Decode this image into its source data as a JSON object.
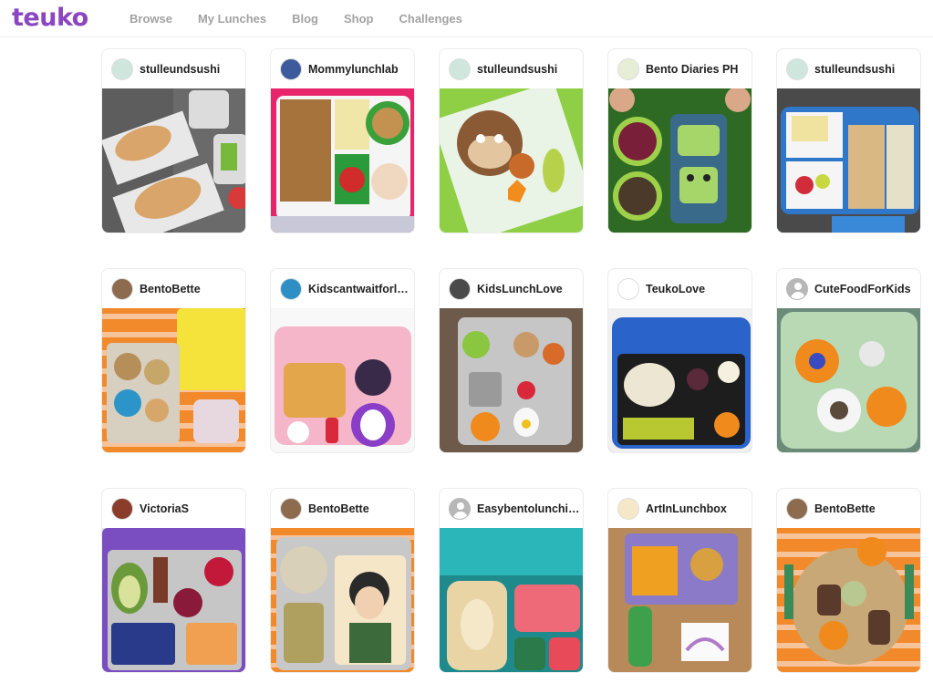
{
  "app": {
    "logo": "teuko"
  },
  "nav": [
    {
      "label": "Browse"
    },
    {
      "label": "My Lunches"
    },
    {
      "label": "Blog"
    },
    {
      "label": "Shop"
    },
    {
      "label": "Challenges"
    }
  ],
  "cards": [
    {
      "user": "stulleundsushi",
      "avatar": "#cfe6dd",
      "scene": "gingerbread",
      "colors": [
        "#5d5d5d",
        "#d9a56a",
        "#e8e8e8",
        "#78b83a"
      ]
    },
    {
      "user": "Mommylunchlab",
      "avatar": "#3d5a9c",
      "scene": "bento4",
      "colors": [
        "#e8246a",
        "#a7733c",
        "#f0e6a8",
        "#d12c2c"
      ]
    },
    {
      "user": "stulleundsushi",
      "avatar": "#cfe6dd",
      "scene": "monkey",
      "colors": [
        "#8fcf46",
        "#8a5a35",
        "#f28c1c",
        "#e8e8e8"
      ]
    },
    {
      "user": "Bento Diaries PH",
      "avatar": "#e6efd6",
      "scene": "frog",
      "colors": [
        "#3c7a2a",
        "#7a1f3a",
        "#a6d66a",
        "#4b3a2a"
      ]
    },
    {
      "user": "stulleundsushi",
      "avatar": "#cfe6dd",
      "scene": "sandwich",
      "colors": [
        "#2f77c9",
        "#d9b884",
        "#f08a1c",
        "#e7e0c9"
      ]
    },
    {
      "user": "BentoBette",
      "avatar": "#8d6b4e",
      "scene": "tray",
      "colors": [
        "#f28a2c",
        "#b58e5a",
        "#f5e23a",
        "#2b95c9"
      ]
    },
    {
      "user": "Kidscantwaitforlunch",
      "avatar": "#2e8fc4",
      "scene": "waffle",
      "colors": [
        "#f4b6c8",
        "#e3a64a",
        "#8a3ec7",
        "#ffffff"
      ]
    },
    {
      "user": "KidsLunchLove",
      "avatar": "#4a4a4a",
      "scene": "metal",
      "colors": [
        "#6d5a4a",
        "#c6c6c6",
        "#8ac640",
        "#f08a1c"
      ]
    },
    {
      "user": "TeukoLove",
      "avatar": "#ffffff",
      "scene": "bluebox",
      "colors": [
        "#2a63c9",
        "#1d1d1d",
        "#ede6d3",
        "#f08a1c"
      ]
    },
    {
      "user": "CuteFoodForKids",
      "avatar": "generic",
      "scene": "green",
      "colors": [
        "#b9d9b5",
        "#f08a1c",
        "#5a4a3a",
        "#e8e8e8"
      ]
    },
    {
      "user": "VictoriaS",
      "avatar": "#8a3d2a",
      "scene": "avocado",
      "colors": [
        "#7a4ec0",
        "#6b9a3a",
        "#c2183a",
        "#f0a050"
      ]
    },
    {
      "user": "BentoBette",
      "avatar": "#8d6b4e",
      "scene": "anime",
      "colors": [
        "#f28a2c",
        "#c8c8c8",
        "#3d6a3a",
        "#d8c8a0"
      ]
    },
    {
      "user": "Easybentolunchideas",
      "avatar": "generic",
      "scene": "teal",
      "colors": [
        "#2bb6b9",
        "#ef6a78",
        "#e8d4a4",
        "#1f8a8c"
      ]
    },
    {
      "user": "ArtInLunchbox",
      "avatar": "#f4e8c8",
      "scene": "purple",
      "colors": [
        "#b88a5a",
        "#8a7ac8",
        "#f0a020",
        "#3ea04a"
      ]
    },
    {
      "user": "BentoBette",
      "avatar": "#8d6b4e",
      "scene": "plate",
      "colors": [
        "#f28a2c",
        "#c9a878",
        "#3a8a5a",
        "#5a3a2a"
      ]
    }
  ]
}
